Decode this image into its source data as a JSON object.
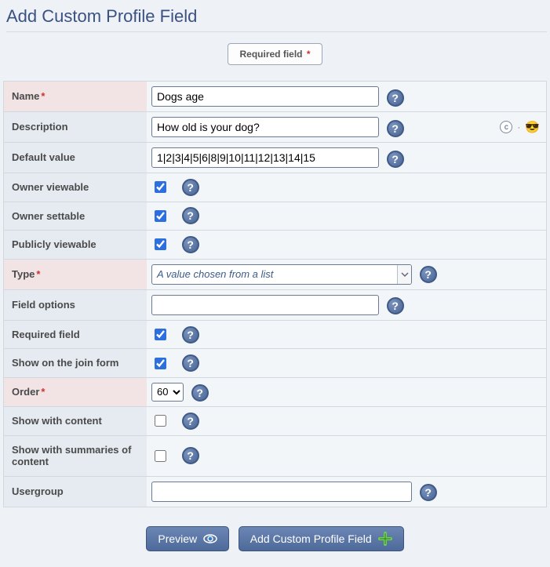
{
  "page_title": "Add Custom Profile Field",
  "required_banner": "Required field",
  "fields": {
    "name": {
      "label": "Name",
      "value": "Dogs age",
      "required": true
    },
    "description": {
      "label": "Description",
      "value": "How old is your dog?"
    },
    "default_value": {
      "label": "Default value",
      "value": "1|2|3|4|5|6|8|9|10|11|12|13|14|15"
    },
    "owner_viewable": {
      "label": "Owner viewable",
      "checked": true
    },
    "owner_settable": {
      "label": "Owner settable",
      "checked": true
    },
    "publicly_viewable": {
      "label": "Publicly viewable",
      "checked": true
    },
    "type": {
      "label": "Type",
      "value": "A value chosen from a list",
      "required": true
    },
    "field_options": {
      "label": "Field options",
      "value": ""
    },
    "required_field": {
      "label": "Required field",
      "checked": true
    },
    "show_on_join": {
      "label": "Show on the join form",
      "checked": true
    },
    "order": {
      "label": "Order",
      "value": "60",
      "options": [
        "60"
      ],
      "required": true
    },
    "show_with_content": {
      "label": "Show with content",
      "checked": false
    },
    "show_with_summaries": {
      "label": "Show with summaries of content",
      "checked": false
    },
    "usergroup": {
      "label": "Usergroup",
      "value": ""
    }
  },
  "buttons": {
    "preview": "Preview",
    "submit": "Add Custom Profile Field"
  }
}
